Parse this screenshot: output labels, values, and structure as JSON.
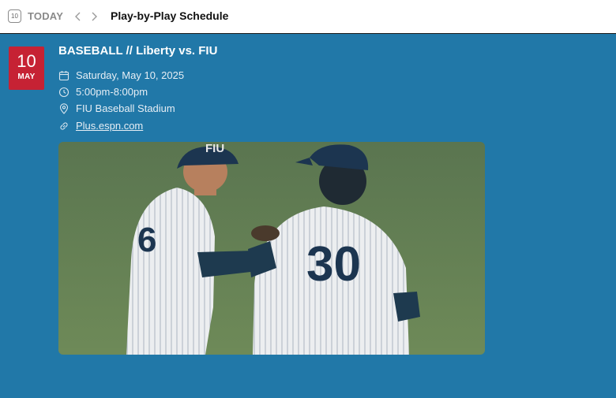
{
  "header": {
    "today_icon_text": "10",
    "today_label": "TODAY",
    "title": "Play-by-Play Schedule"
  },
  "event": {
    "date_badge": {
      "day": "10",
      "month": "MAY"
    },
    "title": "BASEBALL // Liberty vs. FIU",
    "date": "Saturday, May 10, 2025",
    "time": "5:00pm-8:00pm",
    "location": "FIU Baseball Stadium",
    "link_text": "Plus.espn.com",
    "image": {
      "cap_letters": "FIU",
      "jersey_left": "6",
      "jersey_right": "30"
    }
  },
  "colors": {
    "main_bg": "#2178a8",
    "badge_bg": "#c62234",
    "grass": "#5e7a4f"
  }
}
